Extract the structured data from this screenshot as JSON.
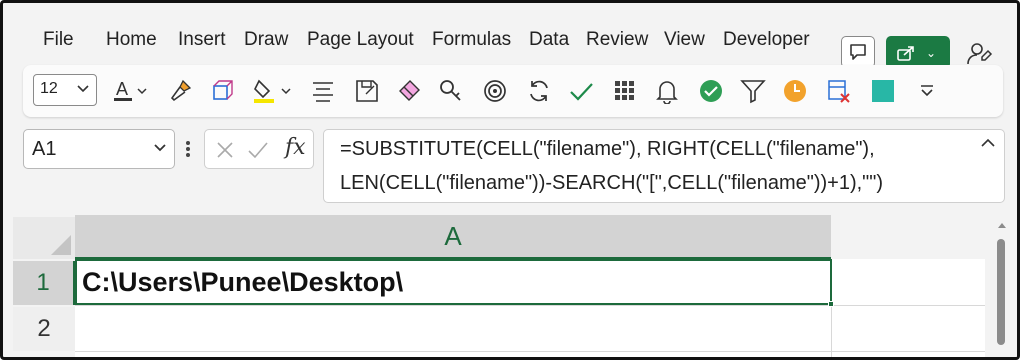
{
  "menu": {
    "items": [
      "File",
      "Home",
      "Insert",
      "Draw",
      "Page Layout",
      "Formulas",
      "Data",
      "Review",
      "View",
      "Developer"
    ]
  },
  "header_actions": {
    "comment_icon": "comment-icon",
    "share_icon": "share-icon",
    "share_color": "#1b7a43",
    "collab_icon": "person-icon"
  },
  "ribbon": {
    "font_size": "12",
    "icons": [
      "font-color-icon",
      "format-painter-icon",
      "3d-model-icon",
      "fill-color-icon",
      "align-icon",
      "save-as-icon",
      "eraser-icon",
      "find-icon",
      "target-icon",
      "refresh-icon",
      "checkmark-icon",
      "grid-icon",
      "bell-icon",
      "green-check-icon",
      "filter-icon",
      "clock-icon",
      "delete-sheet-icon",
      "teal-square-icon",
      "more-icon"
    ]
  },
  "formula_bar": {
    "name_box": "A1",
    "fx_label": "fx",
    "formula_line1": "=SUBSTITUTE(CELL(\"filename\"), RIGHT(CELL(\"filename\"),",
    "formula_line2": "LEN(CELL(\"filename\"))-SEARCH(\"[\",CELL(\"filename\"))+1),\"\")"
  },
  "sheet": {
    "column_header": "A",
    "row_headers": [
      "1",
      "2"
    ],
    "cells": {
      "A1": "C:\\Users\\Punee\\Desktop\\"
    },
    "accent_color": "#1d6a3c"
  }
}
